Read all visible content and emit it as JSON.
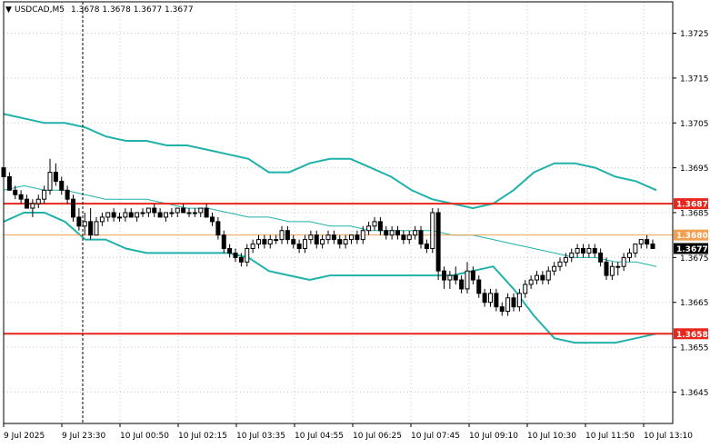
{
  "header": {
    "marker": "▼",
    "symbol_text": "USDCAD,M5",
    "ohlc_text": "1.3678 1.3678 1.3677 1.3677"
  },
  "colors": {
    "background": "#ffffff",
    "grid": "#c8c8c8",
    "axis": "#000000",
    "candle": "#000000",
    "bollinger": "#20b2aa",
    "moving_average": "#20b2aa",
    "support_resistance": "#e8261b",
    "bid_line": "#f0a050",
    "current_price_tag_bg": "#000000",
    "current_price_tag_fg": "#ffffff",
    "level_tag_bg": "#e8261b",
    "level_tag_fg": "#ffffff",
    "bid_tag_bg": "#f0a050",
    "bid_tag_fg": "#ffffff"
  },
  "chart_data": {
    "type": "candlestick",
    "symbol": "USDCAD",
    "timeframe": "M5",
    "ylim": [
      1.3638,
      1.3732
    ],
    "grid": true,
    "y_ticks": [
      "1.3725",
      "1.3715",
      "1.3705",
      "1.3695",
      "1.3685",
      "1.3675",
      "1.3665",
      "1.3655",
      "1.3645"
    ],
    "y_tick_values": [
      1.3725,
      1.3715,
      1.3705,
      1.3695,
      1.3685,
      1.3675,
      1.3665,
      1.3655,
      1.3645
    ],
    "x_ticks": [
      "9 Jul 2025",
      "9 Jul 23:30",
      "10 Jul 00:50",
      "10 Jul 02:15",
      "10 Jul 03:35",
      "10 Jul 04:55",
      "10 Jul 06:25",
      "10 Jul 07:45",
      "10 Jul 09:10",
      "10 Jul 10:30",
      "10 Jul 11:50",
      "10 Jul 13:10"
    ],
    "horizontal_levels": [
      {
        "label": "1.3687",
        "value": 1.3687,
        "kind": "resistance"
      },
      {
        "label": "1.3658",
        "value": 1.3658,
        "kind": "support"
      }
    ],
    "bid_level": {
      "label": "1.3680",
      "value": 1.368
    },
    "current_price": {
      "label": "1.3677",
      "value": 1.3677
    },
    "candles": [
      [
        1.3695,
        1.3696,
        1.3692,
        1.3693
      ],
      [
        1.3693,
        1.3694,
        1.369,
        1.369
      ],
      [
        1.369,
        1.3691,
        1.3688,
        1.3689
      ],
      [
        1.3689,
        1.369,
        1.3687,
        1.3688
      ],
      [
        1.3688,
        1.3689,
        1.3686,
        1.3686
      ],
      [
        1.3686,
        1.3688,
        1.3684,
        1.3687
      ],
      [
        1.3687,
        1.3689,
        1.3686,
        1.3688
      ],
      [
        1.3688,
        1.3691,
        1.3687,
        1.369
      ],
      [
        1.369,
        1.3697,
        1.3689,
        1.3694
      ],
      [
        1.3694,
        1.3696,
        1.3691,
        1.3692
      ],
      [
        1.3692,
        1.3693,
        1.3689,
        1.369
      ],
      [
        1.369,
        1.3691,
        1.3687,
        1.3688
      ],
      [
        1.3688,
        1.3689,
        1.3683,
        1.3684
      ],
      [
        1.3684,
        1.3686,
        1.3681,
        1.3682
      ],
      [
        1.3682,
        1.3685,
        1.368,
        1.3683
      ],
      [
        1.3683,
        1.3686,
        1.3679,
        1.368
      ],
      [
        1.368,
        1.3684,
        1.368,
        1.3683
      ],
      [
        1.3683,
        1.3685,
        1.3682,
        1.3684
      ],
      [
        1.3684,
        1.3685,
        1.3683,
        1.3685
      ],
      [
        1.3685,
        1.3686,
        1.3683,
        1.3684
      ],
      [
        1.3684,
        1.3685,
        1.3683,
        1.3684
      ],
      [
        1.3684,
        1.3686,
        1.3683,
        1.3685
      ],
      [
        1.3685,
        1.3686,
        1.3684,
        1.3684
      ],
      [
        1.3684,
        1.3685,
        1.3683,
        1.3685
      ],
      [
        1.3685,
        1.3686,
        1.3684,
        1.3685
      ],
      [
        1.3685,
        1.3686,
        1.3684,
        1.3686
      ],
      [
        1.3686,
        1.3687,
        1.3684,
        1.3685
      ],
      [
        1.3685,
        1.3686,
        1.3684,
        1.3684
      ],
      [
        1.3684,
        1.3685,
        1.3683,
        1.3685
      ],
      [
        1.3685,
        1.3686,
        1.3684,
        1.3685
      ],
      [
        1.3685,
        1.3686,
        1.3684,
        1.3686
      ],
      [
        1.3686,
        1.3687,
        1.3685,
        1.3685
      ],
      [
        1.3685,
        1.3686,
        1.3684,
        1.3685
      ],
      [
        1.3685,
        1.3686,
        1.3684,
        1.3685
      ],
      [
        1.3685,
        1.3686,
        1.3684,
        1.3686
      ],
      [
        1.3686,
        1.3687,
        1.3684,
        1.3684
      ],
      [
        1.3684,
        1.3685,
        1.3682,
        1.3683
      ],
      [
        1.3683,
        1.3684,
        1.3679,
        1.368
      ],
      [
        1.368,
        1.3681,
        1.3676,
        1.3677
      ],
      [
        1.3677,
        1.3678,
        1.3675,
        1.3676
      ],
      [
        1.3676,
        1.3677,
        1.3674,
        1.3675
      ],
      [
        1.3675,
        1.3676,
        1.3673,
        1.3674
      ],
      [
        1.3674,
        1.3678,
        1.3673,
        1.3677
      ],
      [
        1.3677,
        1.3679,
        1.3676,
        1.3678
      ],
      [
        1.3678,
        1.368,
        1.3677,
        1.3679
      ],
      [
        1.3679,
        1.368,
        1.3677,
        1.3678
      ],
      [
        1.3678,
        1.368,
        1.3677,
        1.3679
      ],
      [
        1.3679,
        1.368,
        1.3678,
        1.3679
      ],
      [
        1.3679,
        1.3682,
        1.3678,
        1.3681
      ],
      [
        1.3681,
        1.3682,
        1.3678,
        1.3679
      ],
      [
        1.3679,
        1.368,
        1.3677,
        1.3678
      ],
      [
        1.3678,
        1.3679,
        1.3676,
        1.3677
      ],
      [
        1.3677,
        1.368,
        1.3676,
        1.3679
      ],
      [
        1.3679,
        1.3681,
        1.3678,
        1.368
      ],
      [
        1.368,
        1.3681,
        1.3677,
        1.3678
      ],
      [
        1.3678,
        1.368,
        1.3677,
        1.3679
      ],
      [
        1.3679,
        1.3681,
        1.3678,
        1.368
      ],
      [
        1.368,
        1.3681,
        1.3678,
        1.3679
      ],
      [
        1.3679,
        1.368,
        1.3677,
        1.3678
      ],
      [
        1.3678,
        1.368,
        1.3677,
        1.3679
      ],
      [
        1.3679,
        1.368,
        1.3678,
        1.368
      ],
      [
        1.368,
        1.3681,
        1.3678,
        1.3679
      ],
      [
        1.3679,
        1.3682,
        1.3678,
        1.3681
      ],
      [
        1.3681,
        1.3683,
        1.368,
        1.3682
      ],
      [
        1.3682,
        1.3684,
        1.3681,
        1.3683
      ],
      [
        1.3683,
        1.3684,
        1.368,
        1.3681
      ],
      [
        1.3681,
        1.3682,
        1.3679,
        1.368
      ],
      [
        1.368,
        1.3682,
        1.3679,
        1.3681
      ],
      [
        1.3681,
        1.3682,
        1.3679,
        1.368
      ],
      [
        1.368,
        1.3681,
        1.3678,
        1.3679
      ],
      [
        1.3679,
        1.3681,
        1.3678,
        1.368
      ],
      [
        1.368,
        1.3682,
        1.3679,
        1.3681
      ],
      [
        1.3681,
        1.3682,
        1.3677,
        1.3678
      ],
      [
        1.3678,
        1.3679,
        1.3676,
        1.3677
      ],
      [
        1.3677,
        1.3686,
        1.3676,
        1.3685
      ],
      [
        1.3685,
        1.3686,
        1.367,
        1.3672
      ],
      [
        1.3672,
        1.3673,
        1.3668,
        1.367
      ],
      [
        1.367,
        1.3672,
        1.3668,
        1.3671
      ],
      [
        1.3671,
        1.3673,
        1.3669,
        1.367
      ],
      [
        1.367,
        1.3671,
        1.3667,
        1.3668
      ],
      [
        1.3668,
        1.3674,
        1.3667,
        1.3672
      ],
      [
        1.3672,
        1.3673,
        1.3669,
        1.367
      ],
      [
        1.367,
        1.3671,
        1.3666,
        1.3667
      ],
      [
        1.3667,
        1.3668,
        1.3664,
        1.3665
      ],
      [
        1.3665,
        1.3668,
        1.3664,
        1.3667
      ],
      [
        1.3667,
        1.3668,
        1.3663,
        1.3664
      ],
      [
        1.3664,
        1.3665,
        1.3662,
        1.3663
      ],
      [
        1.3663,
        1.3667,
        1.3662,
        1.3666
      ],
      [
        1.3666,
        1.3667,
        1.3663,
        1.3664
      ],
      [
        1.3664,
        1.3668,
        1.3663,
        1.3667
      ],
      [
        1.3667,
        1.367,
        1.3666,
        1.3669
      ],
      [
        1.3669,
        1.3671,
        1.3668,
        1.367
      ],
      [
        1.367,
        1.3672,
        1.3669,
        1.3671
      ],
      [
        1.3671,
        1.3672,
        1.3669,
        1.367
      ],
      [
        1.367,
        1.3673,
        1.3669,
        1.3672
      ],
      [
        1.3672,
        1.3674,
        1.3671,
        1.3673
      ],
      [
        1.3673,
        1.3675,
        1.3672,
        1.3674
      ],
      [
        1.3674,
        1.3676,
        1.3673,
        1.3675
      ],
      [
        1.3675,
        1.3677,
        1.3674,
        1.3676
      ],
      [
        1.3676,
        1.3678,
        1.3675,
        1.3677
      ],
      [
        1.3677,
        1.3678,
        1.3675,
        1.3676
      ],
      [
        1.3676,
        1.3678,
        1.3675,
        1.3677
      ],
      [
        1.3677,
        1.3678,
        1.3675,
        1.3676
      ],
      [
        1.3676,
        1.3677,
        1.3673,
        1.3674
      ],
      [
        1.3674,
        1.3675,
        1.367,
        1.3671
      ],
      [
        1.3671,
        1.3674,
        1.367,
        1.3673
      ],
      [
        1.3673,
        1.3674,
        1.3671,
        1.3673
      ],
      [
        1.3673,
        1.3676,
        1.3672,
        1.3675
      ],
      [
        1.3675,
        1.3677,
        1.3674,
        1.3676
      ],
      [
        1.3676,
        1.3678,
        1.3675,
        1.3678
      ],
      [
        1.3678,
        1.3679,
        1.3677,
        1.3679
      ],
      [
        1.3679,
        1.368,
        1.3677,
        1.3678
      ],
      [
        1.3678,
        1.3679,
        1.3677,
        1.3677
      ]
    ],
    "upper_band": [
      1.3707,
      1.3706,
      1.3705,
      1.3705,
      1.3704,
      1.3702,
      1.3701,
      1.3701,
      1.37,
      1.37,
      1.3699,
      1.3698,
      1.3697,
      1.3694,
      1.3694,
      1.3696,
      1.3697,
      1.3697,
      1.3695,
      1.3693,
      1.369,
      1.3688,
      1.3687,
      1.3686,
      1.3687,
      1.369,
      1.3694,
      1.3696,
      1.3696,
      1.3695,
      1.3693,
      1.3692,
      1.369
    ],
    "middle_band": [
      1.369,
      1.3691,
      1.369,
      1.369,
      1.3689,
      1.3688,
      1.3688,
      1.3688,
      1.3687,
      1.3686,
      1.3686,
      1.3685,
      1.3684,
      1.3684,
      1.3683,
      1.3683,
      1.3682,
      1.3682,
      1.3681,
      1.3681,
      1.3681,
      1.3681,
      1.368,
      1.368,
      1.3679,
      1.3678,
      1.3677,
      1.3676,
      1.3675,
      1.3675,
      1.3674,
      1.3674,
      1.3673
    ],
    "lower_band": [
      1.3683,
      1.3685,
      1.3685,
      1.3683,
      1.3679,
      1.3679,
      1.3677,
      1.3676,
      1.3676,
      1.3676,
      1.3676,
      1.3676,
      1.3675,
      1.3672,
      1.3671,
      1.367,
      1.3671,
      1.3671,
      1.3671,
      1.3671,
      1.3671,
      1.3671,
      1.3671,
      1.3672,
      1.3673,
      1.3668,
      1.3662,
      1.3657,
      1.3656,
      1.3656,
      1.3656,
      1.3657,
      1.3658
    ]
  }
}
